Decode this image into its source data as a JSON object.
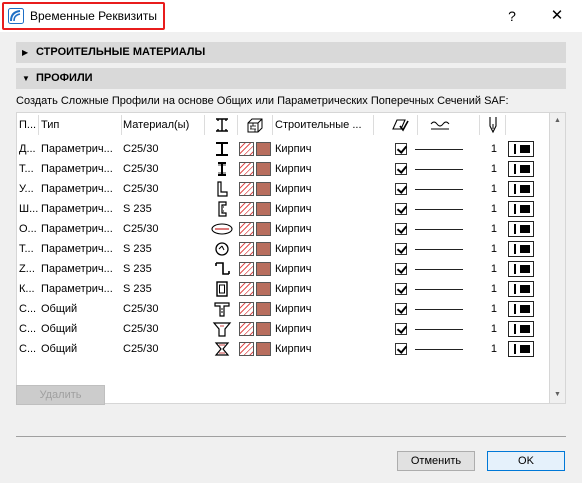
{
  "window": {
    "title": "Временные Реквизиты",
    "help": "?",
    "close": "✕"
  },
  "sections": {
    "materials": {
      "label": "СТРОИТЕЛЬНЫЕ МАТЕРИАЛЫ",
      "arrow": "▶"
    },
    "profiles": {
      "label": "ПРОФИЛИ",
      "arrow": "▼"
    }
  },
  "description": "Создать Сложные Профили на основе Общих или Параметрических Поперечных Сечений SAF:",
  "table": {
    "headers": {
      "name": "П...",
      "type": "Тип",
      "material": "Материал(ы)",
      "building_material": "Строительные ..."
    },
    "rows": [
      {
        "name": "Д...",
        "type": "Параметрич...",
        "material": "C25/30",
        "profile": "i-beam",
        "bmat": "Кирпич",
        "count": "1"
      },
      {
        "name": "Т...",
        "type": "Параметрич...",
        "material": "C25/30",
        "profile": "i-narrow",
        "bmat": "Кирпич",
        "count": "1"
      },
      {
        "name": "У...",
        "type": "Параметрич...",
        "material": "C25/30",
        "profile": "angle",
        "bmat": "Кирпич",
        "count": "1"
      },
      {
        "name": "Ш...",
        "type": "Параметрич...",
        "material": "S 235",
        "profile": "c-channel",
        "bmat": "Кирпич",
        "count": "1"
      },
      {
        "name": "О...",
        "type": "Параметрич...",
        "material": "C25/30",
        "profile": "oval",
        "bmat": "Кирпич",
        "count": "1"
      },
      {
        "name": "Т...",
        "type": "Параметрич...",
        "material": "S 235",
        "profile": "circle",
        "bmat": "Кирпич",
        "count": "1"
      },
      {
        "name": "Z...",
        "type": "Параметрич...",
        "material": "S 235",
        "profile": "z-section",
        "bmat": "Кирпич",
        "count": "1"
      },
      {
        "name": "К...",
        "type": "Параметрич...",
        "material": "S 235",
        "profile": "box",
        "bmat": "Кирпич",
        "count": "1"
      },
      {
        "name": "С...",
        "type": "Общий",
        "material": "C25/30",
        "profile": "t-beam",
        "bmat": "Кирпич",
        "count": "1"
      },
      {
        "name": "С...",
        "type": "Общий",
        "material": "C25/30",
        "profile": "trapezoid",
        "bmat": "Кирпич",
        "count": "1"
      },
      {
        "name": "С...",
        "type": "Общий",
        "material": "C25/30",
        "profile": "hourglass",
        "bmat": "Кирпич",
        "count": "1"
      }
    ]
  },
  "buttons": {
    "delete": "Удалить",
    "cancel": "Отменить",
    "ok": "OK"
  },
  "colors": {
    "title_highlight": "#e81c1c",
    "section_bg": "#d9d9d9",
    "brick": "#b86e5e",
    "hatch": "#e05050"
  }
}
